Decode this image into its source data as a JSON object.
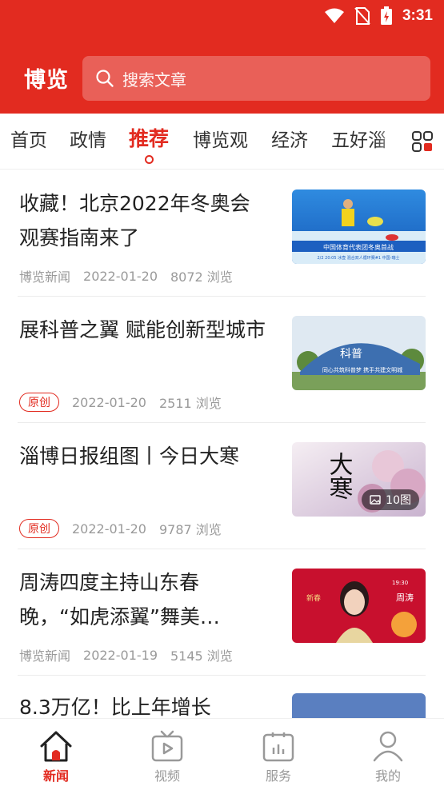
{
  "status": {
    "time": "3:31"
  },
  "header": {
    "brand": "博览",
    "search_placeholder": "搜索文章"
  },
  "tabs": [
    {
      "label": "首页"
    },
    {
      "label": "政情"
    },
    {
      "label": "推荐"
    },
    {
      "label": "博览观"
    },
    {
      "label": "经济"
    },
    {
      "label": "五好淄"
    }
  ],
  "active_tab": "推荐",
  "articles": [
    {
      "title": "收藏！北京2022年冬奥会观赛指南来了",
      "source": "博览新闻",
      "date": "2022-01-20",
      "views": "8072 浏览",
      "thumb_text": "中国体育代表团冬奥首战",
      "thumb_sub": "2/2 20:05 冰壶 混合双人循环赛#1 中国-瑞士"
    },
    {
      "title": "展科普之翼 赋能创新型城市",
      "badge": "原创",
      "date": "2022-01-20",
      "views": "2511 浏览",
      "thumb_text": "同心共筑科普梦 携手共建文明城",
      "thumb_sub": "科普"
    },
    {
      "title": "淄博日报组图丨今日大寒",
      "badge": "原创",
      "date": "2022-01-20",
      "views": "9787 浏览",
      "thumb_text": "大寒",
      "pic_count": "10图"
    },
    {
      "title": "周涛四度主持山东春晚，“如虎添翼”舞美…",
      "source": "博览新闻",
      "date": "2022-01-19",
      "views": "5145 浏览",
      "thumb_text": "周涛",
      "thumb_sub": "19:30"
    },
    {
      "title": "8.3万亿！比上年增长"
    }
  ],
  "bottom_nav": [
    {
      "label": "新闻",
      "icon": "home-icon"
    },
    {
      "label": "视频",
      "icon": "tv-icon"
    },
    {
      "label": "服务",
      "icon": "service-icon"
    },
    {
      "label": "我的",
      "icon": "user-icon"
    }
  ],
  "colors": {
    "brand_red": "#e22b20",
    "meta_gray": "#9a9a9a"
  }
}
